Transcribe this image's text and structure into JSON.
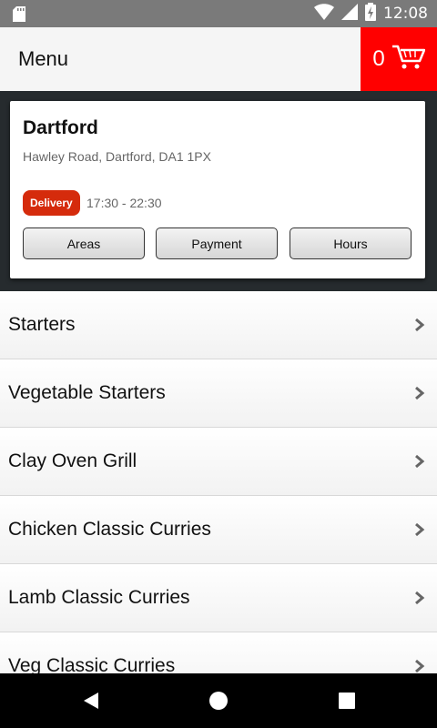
{
  "status_bar": {
    "time": "12:08"
  },
  "app_bar": {
    "title": "Menu",
    "cart_count": "0"
  },
  "store": {
    "name": "Dartford",
    "address": "Hawley Road, Dartford, DA1 1PX",
    "badge": "Delivery",
    "hours": "17:30 - 22:30",
    "buttons": [
      "Areas",
      "Payment",
      "Hours"
    ]
  },
  "menu": {
    "items": [
      {
        "label": "Starters"
      },
      {
        "label": "Vegetable Starters"
      },
      {
        "label": "Clay Oven Grill"
      },
      {
        "label": "Chicken Classic Curries"
      },
      {
        "label": "Lamb Classic Curries"
      },
      {
        "label": "Veg Classic Curries"
      }
    ]
  },
  "colors": {
    "accent_red": "#ff0000",
    "badge_red": "#d52b0c",
    "header_bg": "#262b2e"
  }
}
